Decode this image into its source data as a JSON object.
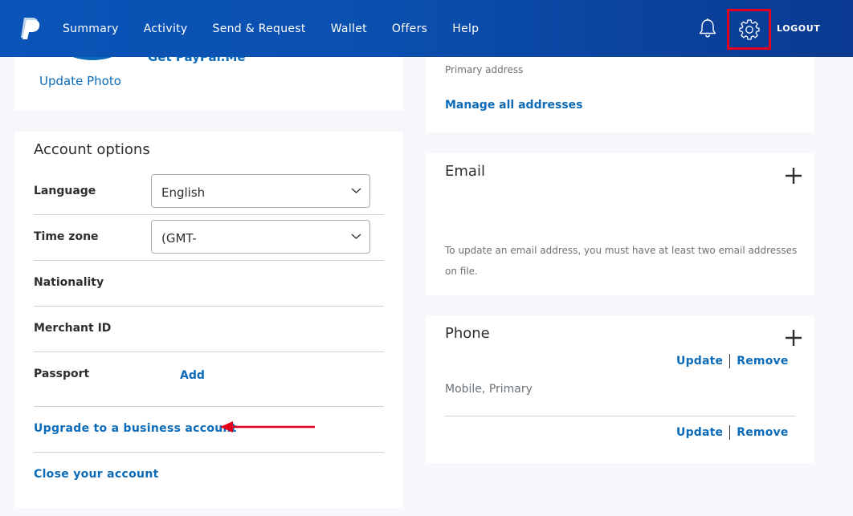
{
  "nav": {
    "items": [
      {
        "label": "Summary"
      },
      {
        "label": "Activity"
      },
      {
        "label": "Send & Request"
      },
      {
        "label": "Wallet"
      },
      {
        "label": "Offers"
      },
      {
        "label": "Help"
      }
    ],
    "logout": "LOGOUT",
    "logo_icon": "paypal-logo",
    "bell_icon": "bell-icon",
    "gear_icon": "gear-icon"
  },
  "profile": {
    "getme_label": "Get PayPal.Me",
    "update_photo": "Update Photo"
  },
  "account_options": {
    "title": "Account options",
    "language_label": "Language",
    "language_value": "English",
    "timezone_label": "Time zone",
    "timezone_value": "(GMT-",
    "nationality_label": "Nationality",
    "merchant_label": "Merchant ID",
    "passport_label": "Passport",
    "passport_add": "Add",
    "upgrade_link": "Upgrade to a business account",
    "close_link": "Close your account"
  },
  "address": {
    "primary": "Primary address",
    "manage": "Manage all addresses"
  },
  "email": {
    "title": "Email",
    "note": "To update an email address, you must have at least two email addresses on file."
  },
  "phone": {
    "title": "Phone",
    "update": "Update",
    "remove": "Remove",
    "mobile": "Mobile, Primary"
  },
  "colors": {
    "brand_blue": "#0b6bb8",
    "nav_bg": "#0a4fae",
    "highlight_red": "#e3001b"
  }
}
